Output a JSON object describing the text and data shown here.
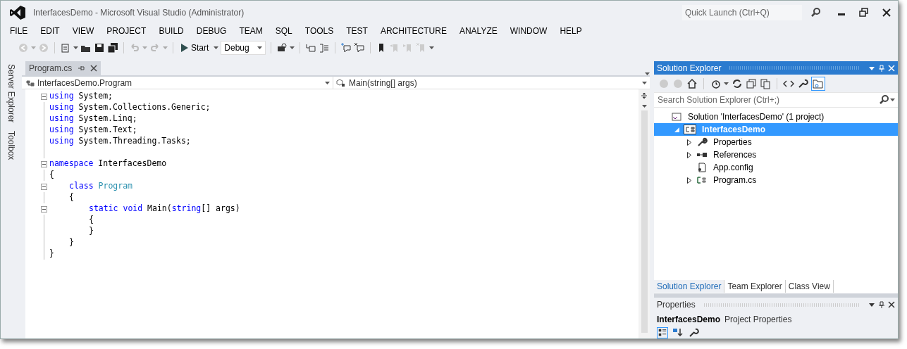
{
  "window": {
    "title": "InterfacesDemo - Microsoft Visual Studio (Administrator)",
    "quick_launch": {
      "placeholder": "Quick Launch (Ctrl+Q)"
    }
  },
  "menu": [
    "FILE",
    "EDIT",
    "VIEW",
    "PROJECT",
    "BUILD",
    "DEBUG",
    "TEAM",
    "SQL",
    "TOOLS",
    "TEST",
    "ARCHITECTURE",
    "ANALYZE",
    "WINDOW",
    "HELP"
  ],
  "toolbar": {
    "start": "Start",
    "configuration": "Debug"
  },
  "side_tabs": [
    "Server Explorer",
    "Toolbox"
  ],
  "editor": {
    "tabs": [
      {
        "label": "Program.cs",
        "selected": true
      }
    ],
    "nav": {
      "type": "InterfacesDemo.Program",
      "member": "Main(string[] args)"
    },
    "lines": [
      {
        "collapsible": true,
        "tokens": [
          {
            "text": "using",
            "kind": "keyword"
          },
          {
            "text": " System;",
            "kind": "plain"
          }
        ]
      },
      {
        "collapsible": false,
        "tokens": [
          {
            "text": "using",
            "kind": "keyword"
          },
          {
            "text": " System.Collections.Generic;",
            "kind": "plain"
          }
        ]
      },
      {
        "collapsible": false,
        "tokens": [
          {
            "text": "using",
            "kind": "keyword"
          },
          {
            "text": " System.Linq;",
            "kind": "plain"
          }
        ]
      },
      {
        "collapsible": false,
        "tokens": [
          {
            "text": "using",
            "kind": "keyword"
          },
          {
            "text": " System.Text;",
            "kind": "plain"
          }
        ]
      },
      {
        "collapsible": false,
        "tokens": [
          {
            "text": "using",
            "kind": "keyword"
          },
          {
            "text": " System.Threading.Tasks;",
            "kind": "plain"
          }
        ]
      },
      {
        "collapsible": false
      },
      {
        "collapsible": true,
        "tokens": [
          {
            "text": "namespace",
            "kind": "keyword"
          },
          {
            "text": " InterfacesDemo",
            "kind": "plain"
          }
        ]
      },
      {
        "collapsible": false,
        "tokens": [
          {
            "text": "{",
            "kind": "plain"
          }
        ],
        "children": [
          {
            "collapsible": true,
            "tokens": [
              {
                "text": "class",
                "kind": "keyword"
              },
              {
                "text": " Program",
                "kind": "type"
              }
            ]
          },
          {
            "collapsible": false,
            "tokens": [
              {
                "text": "{",
                "kind": "plain"
              }
            ],
            "children": [
              {
                "collapsible": true,
                "tokens": [
                  {
                    "text": "static void",
                    "kind": "keyword"
                  },
                  {
                    "text": " Main(",
                    "kind": "plain"
                  },
                  {
                    "text": "string",
                    "kind": "keyword"
                  },
                  {
                    "text": "[] args)",
                    "kind": "plain"
                  }
                ]
              },
              {
                "collapsible": false,
                "tokens": [
                  {
                    "text": "{",
                    "kind": "plain"
                  }
                ]
              },
              {
                "collapsible": false,
                "tokens": [
                  {
                    "text": "}",
                    "kind": "plain"
                  }
                ]
              }
            ]
          },
          {
            "collapsible": false,
            "tokens": [
              {
                "text": "}",
                "kind": "plain"
              }
            ]
          }
        ]
      },
      {
        "collapsible": false,
        "tokens": [
          {
            "text": "}",
            "kind": "plain"
          }
        ]
      }
    ]
  },
  "solution_explorer": {
    "title": "Solution Explorer",
    "search": {
      "placeholder": "Search Solution Explorer (Ctrl+;)"
    },
    "tree": [
      {
        "label": "Solution 'InterfacesDemo' (1 project)",
        "kind": "solution",
        "selected": false,
        "children": [
          {
            "label": "InterfacesDemo",
            "kind": "project",
            "selected": true,
            "expanded": true,
            "children": [
              {
                "label": "Properties",
                "kind": "properties",
                "selected": false,
                "expanded": false
              },
              {
                "label": "References",
                "kind": "references",
                "selected": false,
                "expanded": false
              },
              {
                "label": "App.config",
                "kind": "config",
                "selected": false
              },
              {
                "label": "Program.cs",
                "kind": "csfile",
                "selected": false,
                "expanded": false
              }
            ]
          }
        ]
      }
    ],
    "tabs": [
      {
        "label": "Solution Explorer",
        "selected": true
      },
      {
        "label": "Team Explorer",
        "selected": false
      },
      {
        "label": "Class View",
        "selected": false
      }
    ]
  },
  "properties": {
    "title": "Properties",
    "object": "InterfacesDemo",
    "object_type": "Project Properties"
  }
}
